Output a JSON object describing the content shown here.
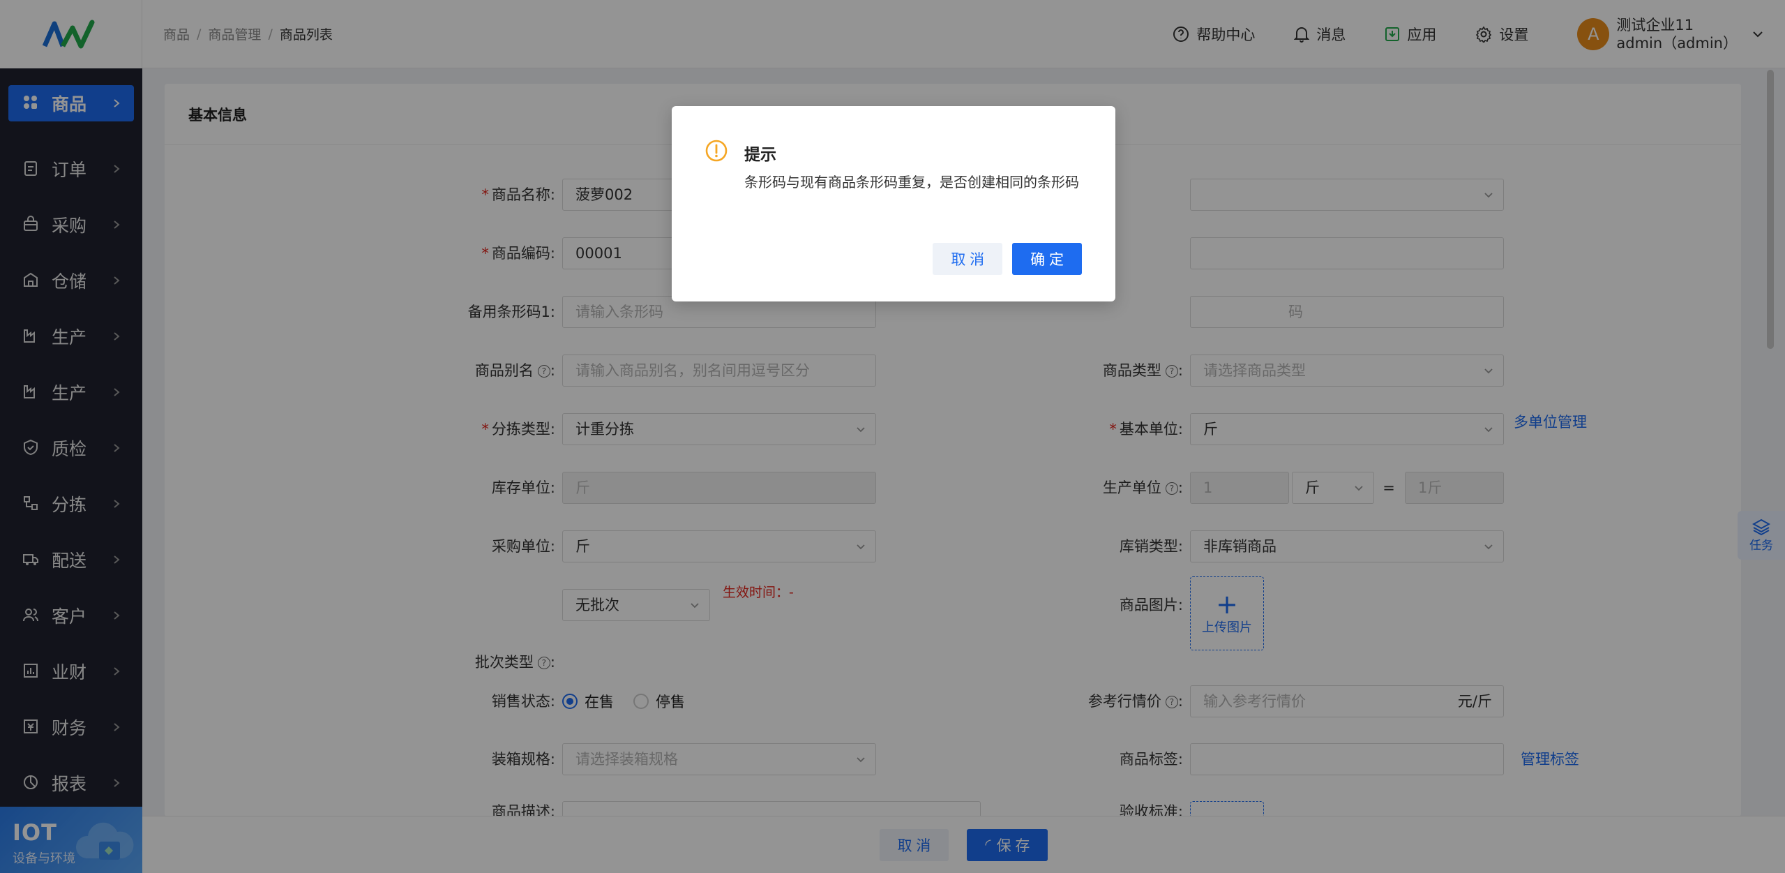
{
  "breadcrumb": [
    "商品",
    "商品管理",
    "商品列表"
  ],
  "header": {
    "help": "帮助中心",
    "messages": "消息",
    "apps": "应用",
    "settings": "设置",
    "avatar_letter": "A",
    "company": "测试企业11",
    "user": "admin（admin）"
  },
  "sidebar": {
    "items": [
      "商品",
      "订单",
      "采购",
      "仓储",
      "生产",
      "生产",
      "质检",
      "分拣",
      "配送",
      "客户",
      "业财",
      "财务",
      "报表"
    ],
    "iot_title": "IOT",
    "iot_sub": "设备与环境"
  },
  "section": {
    "title": "基本信息"
  },
  "form": {
    "name_label": "商品名称:",
    "name_value": "菠萝002",
    "code_label": "商品编码:",
    "code_value": "00001",
    "alt_barcode_label": "备用条形码1:",
    "alt_barcode_ph": "请输入条形码",
    "right_barcode_ph": "码",
    "alias_label": "商品别名",
    "alias_ph": "请输入商品别名，别名间用逗号区分",
    "type_label": "商品类型",
    "type_ph": "请选择商品类型",
    "sort_label": "分拣类型:",
    "sort_value": "计重分拣",
    "base_unit_label": "基本单位:",
    "base_unit_value": "斤",
    "multi_unit_link": "多单位管理",
    "stock_unit_label": "库存单位:",
    "stock_unit_value": "斤",
    "prod_unit_label": "生产单位",
    "prod_unit_qty": "1",
    "prod_unit_sel": "斤",
    "prod_unit_eq": "=",
    "prod_unit_result": "1斤",
    "purchase_unit_label": "采购单位:",
    "purchase_unit_value": "斤",
    "stock_type_label": "库销类型:",
    "stock_type_value": "非库销商品",
    "batch_label": "批次类型",
    "batch_value": "无批次",
    "effective_time": "生效时间：-",
    "image_label": "商品图片:",
    "upload_text": "上传图片",
    "sale_status_label": "销售状态:",
    "on_sale": "在售",
    "off_sale": "停售",
    "ref_price_label": "参考行情价",
    "ref_price_ph": "输入参考行情价",
    "ref_price_unit": "元/斤",
    "packing_label": "装箱规格:",
    "packing_ph": "请选择装箱规格",
    "tag_label": "商品标签:",
    "tag_link": "管理标签",
    "desc_label": "商品描述:",
    "accept_label": "验收标准:",
    "colon": ":"
  },
  "bottom": {
    "cancel": "取 消",
    "save": "保 存"
  },
  "task_label": "任务",
  "dialog": {
    "title": "提示",
    "message": "条形码与现有商品条形码重复，是否创建相同的条形码",
    "cancel": "取 消",
    "confirm": "确 定"
  }
}
